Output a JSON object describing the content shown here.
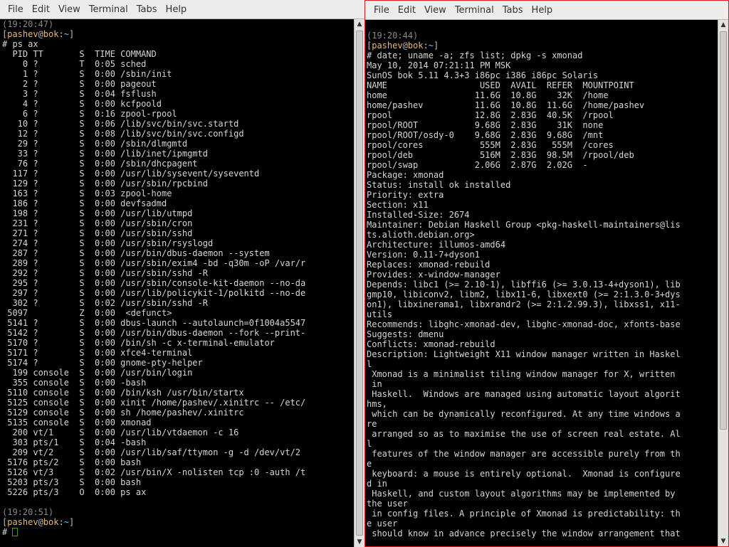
{
  "menus": [
    "File",
    "Edit",
    "View",
    "Terminal",
    "Tabs",
    "Help"
  ],
  "prompt": {
    "user": "pashev",
    "host": "bok",
    "path": "~",
    "symbol": "#"
  },
  "left": {
    "time1": "(19:20:47)",
    "command": "ps ax",
    "ps_header": "  PID TT       S  TIME COMMAND",
    "ps_rows": [
      "    0 ?        T  0:05 sched",
      "    1 ?        S  0:00 /sbin/init",
      "    2 ?        S  0:00 pageout",
      "    3 ?        S  0:04 fsflush",
      "    4 ?        S  0:00 kcfpoold",
      "    6 ?        S  0:16 zpool-rpool",
      "   10 ?        S  0:06 /lib/svc/bin/svc.startd",
      "   12 ?        S  0:08 /lib/svc/bin/svc.configd",
      "   29 ?        S  0:00 /sbin/dlmgmtd",
      "   33 ?        S  0:00 /lib/inet/ipmgmtd",
      "   76 ?        S  0:00 /sbin/dhcpagent",
      "  117 ?        S  0:00 /usr/lib/sysevent/syseventd",
      "  129 ?        S  0:00 /usr/sbin/rpcbind",
      "  163 ?        S  0:03 zpool-home",
      "  186 ?        S  0:00 devfsadmd",
      "  198 ?        S  0:00 /usr/lib/utmpd",
      "  231 ?        S  0:00 /usr/sbin/cron",
      "  271 ?        S  0:00 /usr/sbin/sshd",
      "  274 ?        S  0:00 /usr/sbin/rsyslogd",
      "  287 ?        S  0:00 /usr/bin/dbus-daemon --system",
      "  289 ?        S  0:00 /usr/sbin/exim4 -bd -q30m -oP /var/r",
      "  292 ?        S  0:00 /usr/sbin/sshd -R",
      "  295 ?        S  0:00 /usr/sbin/console-kit-daemon --no-da",
      "  297 ?        S  0:00 /usr/lib/policykit-1/polkitd --no-de",
      "  302 ?        S  0:02 /usr/sbin/sshd -R",
      " 5097          Z  0:00  <defunct>",
      " 5141 ?        S  0:00 dbus-launch --autolaunch=0f1004a5547",
      " 5142 ?        S  0:00 /usr/bin/dbus-daemon --fork --print-",
      " 5170 ?        S  0:00 /bin/sh -c x-terminal-emulator",
      " 5171 ?        S  0:00 xfce4-terminal",
      " 5174 ?        S  0:00 gnome-pty-helper",
      "  199 console  S  0:00 /usr/bin/login",
      "  355 console  S  0:00 -bash",
      " 5110 console  S  0:00 /bin/ksh /usr/bin/startx",
      " 5125 console  S  0:00 xinit /home/pashev/.xinitrc -- /etc/",
      " 5129 console  S  0:00 sh /home/pashev/.xinitrc",
      " 5135 console  S  0:00 xmonad",
      "  200 vt/1     S  0:00 /usr/lib/vtdaemon -c 16",
      "  303 pts/1    S  0:04 -bash",
      "  209 vt/2     S  0:00 /usr/lib/saf/ttymon -g -d /dev/vt/2",
      " 5176 pts/2    S  0:00 bash",
      " 5126 vt/3     S  0:02 /usr/bin/X -nolisten tcp :0 -auth /t",
      " 5203 pts/3    S  0:00 bash",
      " 5226 pts/3    O  0:00 ps ax"
    ],
    "time2": "(19:20:51)"
  },
  "right": {
    "time": "(19:20:44)",
    "command": "date; uname -a; zfs list; dpkg -s xmonad",
    "output": [
      "May 10, 2014 07:21:11 PM MSK",
      "SunOS bok 5.11 4.3+3 i86pc i386 i86pc Solaris",
      "NAME                  USED  AVAIL  REFER  MOUNTPOINT",
      "home                 11.6G  10.8G    32K  /home",
      "home/pashev          11.6G  10.8G  11.6G  /home/pashev",
      "rpool                12.8G  2.83G  40.5K  /rpool",
      "rpool/ROOT           9.68G  2.83G    31K  none",
      "rpool/ROOT/osdy-0    9.68G  2.83G  9.68G  /mnt",
      "rpool/cores           555M  2.83G   555M  /cores",
      "rpool/deb             516M  2.83G  98.5M  /rpool/deb",
      "rpool/swap           2.06G  2.87G  2.02G  -",
      "Package: xmonad",
      "Status: install ok installed",
      "Priority: extra",
      "Section: x11",
      "Installed-Size: 2674",
      "Maintainer: Debian Haskell Group <pkg-haskell-maintainers@lis",
      "ts.alioth.debian.org>",
      "Architecture: illumos-amd64",
      "Version: 0.11-7+dyson1",
      "Replaces: xmonad-rebuild",
      "Provides: x-window-manager",
      "Depends: libc1 (>= 2.10-1), libffi6 (>= 3.0.13-4+dyson1), lib",
      "gmp10, libiconv2, libm2, libx11-6, libxext0 (>= 2:1.3.0-3+dys",
      "on1), libxinerama1, libxrandr2 (>= 2:1.2.99.3), libxss1, x11-",
      "utils",
      "Recommends: libghc-xmonad-dev, libghc-xmonad-doc, xfonts-base",
      "Suggests: dmenu",
      "Conflicts: xmonad-rebuild",
      "Description: Lightweight X11 window manager written in Haskel",
      "l",
      " Xmonad is a minimalist tiling window manager for X, written",
      " in",
      " Haskell.  Windows are managed using automatic layout algorit",
      "hms,",
      " which can be dynamically reconfigured. At any time windows a",
      "re",
      " arranged so as to maximise the use of screen real estate. Al",
      "l",
      " features of the window manager are accessible purely from th",
      "e",
      " keyboard: a mouse is entirely optional.  Xmonad is configure",
      "d in",
      " Haskell, and custom layout algorithms may be implemented by",
      "the user",
      " in config files. A principle of Xmonad is predictability: th",
      "e user",
      " should know in advance precisely the window arrangement that"
    ]
  }
}
